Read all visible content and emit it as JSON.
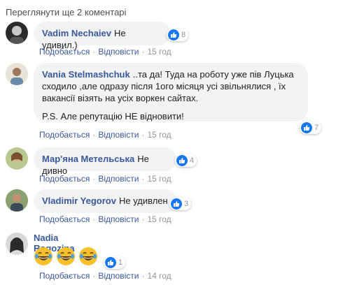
{
  "view_more": "Переглянути ще 2 коментарі",
  "actions": {
    "like": "Подобається",
    "reply": "Відповісти",
    "dot": "·"
  },
  "comments": [
    {
      "author": "Vadim Nechaiev",
      "text": "Не удивил.)",
      "reactions": "8",
      "time": "15 год"
    },
    {
      "author": "Vania Stelmashchuk",
      "text": "..та да! Туда на роботу уже пів Луцька сходило ,але одразу після 1ого місяця усі звільнялися , їх вакансії візять на усіх воркен сайтах.",
      "text2": "P.S. Але репутацію НЕ відновити!",
      "reactions": "7",
      "time": "15 год"
    },
    {
      "author": "Мар'яна Метельська",
      "text": "Не дивно",
      "reactions": "4",
      "time": "15 год"
    },
    {
      "author": "Vladimir Yegorov",
      "text": "Не удивлен",
      "reactions": "3",
      "time": "15 год"
    },
    {
      "author": "Nadia Rogozina",
      "emojis": [
        "grinning-tears-emoji",
        "grinning-tears-emoji",
        "grinning-tears-emoji"
      ],
      "reactions": "1",
      "time": "14 год"
    }
  ],
  "colors": {
    "author": "#385898",
    "bubble": "#f2f3f5",
    "like": "#1877f2",
    "meta": "#90949c"
  }
}
